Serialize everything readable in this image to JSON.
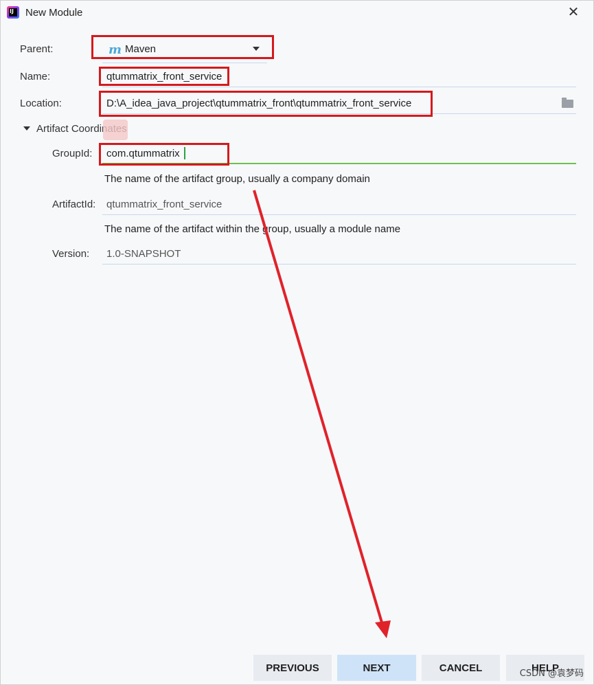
{
  "window": {
    "title": "New Module",
    "close_symbol": "✕"
  },
  "form": {
    "parent": {
      "label": "Parent:",
      "value": "Maven"
    },
    "name": {
      "label": "Name:",
      "value": "qtummatrix_front_service"
    },
    "location": {
      "label": "Location:",
      "value": "D:\\A_idea_java_project\\qtummatrix_front\\qtummatrix_front_service"
    },
    "artifact_section": {
      "label": "Artifact Coordinates"
    },
    "group_id": {
      "label": "GroupId:",
      "value": "com.qtummatrix",
      "hint": "The name of the artifact group, usually a company domain"
    },
    "artifact_id": {
      "label": "ArtifactId:",
      "value": "qtummatrix_front_service",
      "hint": "The name of the artifact within the group, usually a module name"
    },
    "version": {
      "label": "Version:",
      "value": "1.0-SNAPSHOT"
    }
  },
  "buttons": {
    "previous": "PREVIOUS",
    "next": "NEXT",
    "cancel": "CANCEL",
    "help": "HELP"
  },
  "watermark": "CSDN @袁梦码",
  "icons": {
    "app": "intellij-icon",
    "maven": "maven-icon",
    "dropdown": "chevron-down-icon",
    "folder": "folder-icon",
    "expand": "expand-triangle-icon"
  },
  "colors": {
    "annotation_red": "#d4191d",
    "primary_button": "#cfe3f8",
    "button": "#e8ebf0",
    "focus_underline": "#6fbf50"
  }
}
